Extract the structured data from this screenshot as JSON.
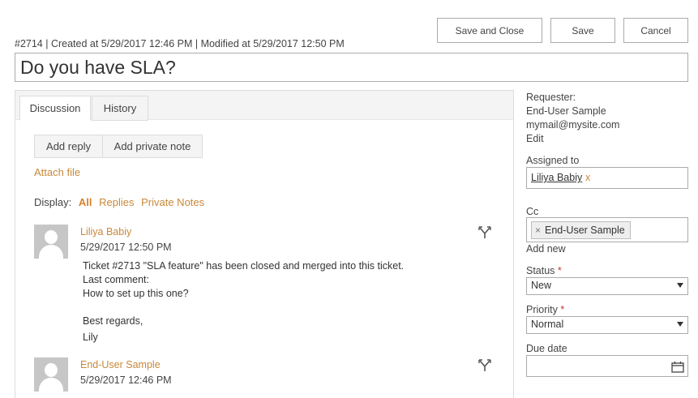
{
  "toolbar": {
    "save_close_label": "Save and Close",
    "save_label": "Save",
    "cancel_label": "Cancel"
  },
  "ticket": {
    "meta": "#2714 | Created at 5/29/2017 12:46 PM | Modified at 5/29/2017 12:50 PM",
    "title": "Do you have SLA?"
  },
  "tabs": [
    {
      "label": "Discussion",
      "active": true
    },
    {
      "label": "History",
      "active": false
    }
  ],
  "actions": {
    "add_reply": "Add reply",
    "add_private_note": "Add private note",
    "attach_file": "Attach file"
  },
  "display_filter": {
    "label": "Display:",
    "options": [
      "All",
      "Replies",
      "Private Notes"
    ],
    "selected": "All"
  },
  "comments": [
    {
      "author": "Liliya Babiy",
      "date": "5/29/2017 12:50 PM",
      "lines": [
        "Ticket #2713 \"SLA feature\" has been closed and merged into this ticket.",
        "Last comment:",
        "How to set up this one?",
        "",
        "Best regards,",
        "Lily"
      ]
    },
    {
      "author": "End-User Sample",
      "date": "5/29/2017 12:46 PM",
      "lines": []
    }
  ],
  "sidebar": {
    "requester_label": "Requester:",
    "requester_name": "End-User Sample",
    "requester_email": "mymail@mysite.com",
    "edit_label": "Edit",
    "assigned_label": "Assigned to",
    "assigned_value": "Liliya Babiy",
    "assigned_remove": "x",
    "cc_label": "Cc",
    "cc_chip": "End-User Sample",
    "cc_chip_remove": "×",
    "add_new_label": "Add new",
    "status_label": "Status",
    "status_value": "New",
    "priority_label": "Priority",
    "priority_value": "Normal",
    "required_mark": "*",
    "due_date_label": "Due date",
    "due_date_value": ""
  },
  "icons": {
    "merge": "merge-icon",
    "calendar": "calendar-icon",
    "avatar": "avatar-placeholder"
  },
  "colors": {
    "link": "#c8883a",
    "filter_active": "#d9822b",
    "required": "#c0392b",
    "border": "#ababab"
  }
}
